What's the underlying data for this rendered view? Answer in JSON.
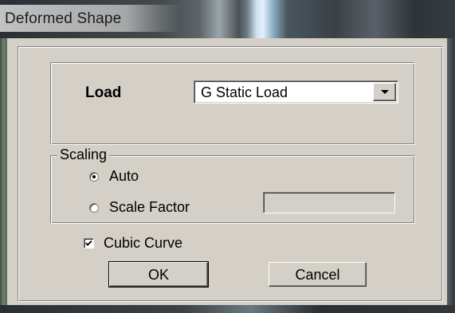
{
  "window": {
    "title": "Deformed Shape"
  },
  "load": {
    "label": "Load",
    "selected": "G Static Load"
  },
  "scaling": {
    "legend": "Scaling",
    "auto_label": "Auto",
    "auto_checked": true,
    "scale_factor_label": "Scale Factor",
    "scale_factor_value": ""
  },
  "cubic_curve": {
    "label": "Cubic Curve",
    "checked": true
  },
  "buttons": {
    "ok_label": "OK",
    "cancel_label": "Cancel"
  },
  "icons": {
    "combo_arrow": "chevron-down-icon",
    "checkmark": "checkmark-icon"
  }
}
